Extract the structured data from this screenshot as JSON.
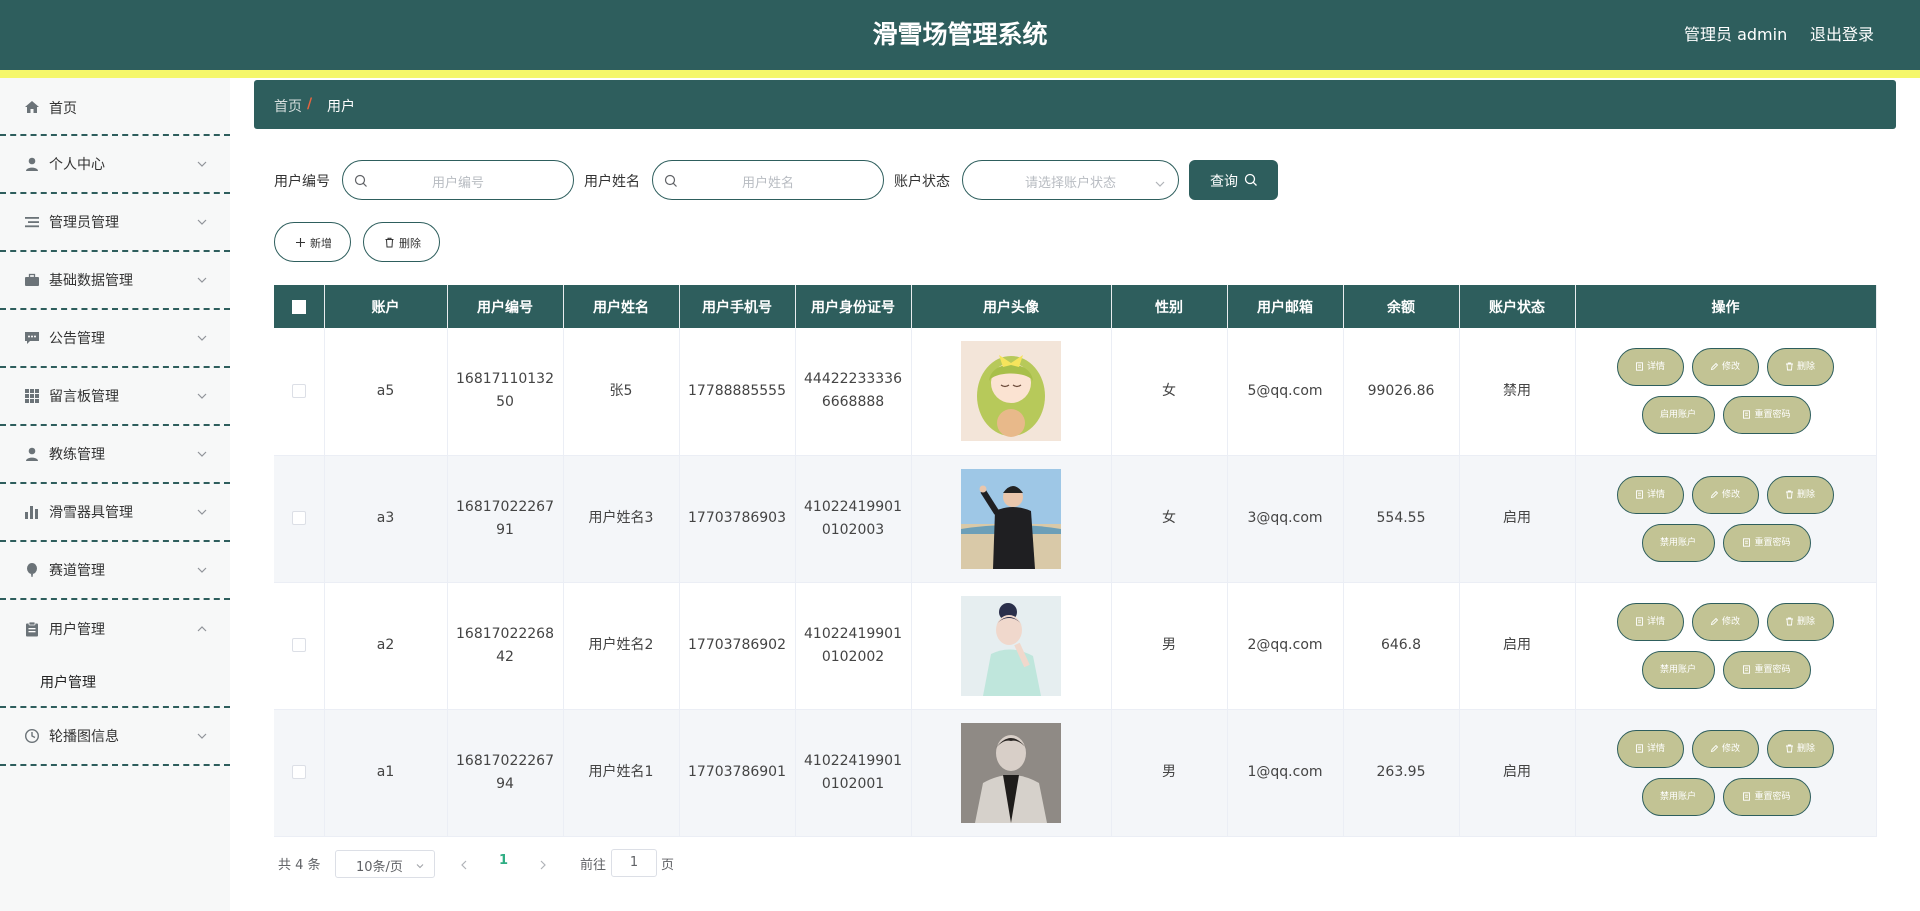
{
  "header": {
    "title": "滑雪场管理系统",
    "user": "管理员 admin",
    "logout": "退出登录"
  },
  "colors": {
    "primary": "#2e5e5d",
    "accent_line": "#f5f76b",
    "op_button": "#c2c394",
    "breadcrumb_sep": "#e7643f",
    "page_active": "#2fae84"
  },
  "sidebar": {
    "items": [
      {
        "label": "首页",
        "icon": "home-icon"
      },
      {
        "label": "个人中心",
        "icon": "user-icon"
      },
      {
        "label": "管理员管理",
        "icon": "list-icon"
      },
      {
        "label": "基础数据管理",
        "icon": "briefcase-icon"
      },
      {
        "label": "公告管理",
        "icon": "message-icon"
      },
      {
        "label": "留言板管理",
        "icon": "grid-icon"
      },
      {
        "label": "教练管理",
        "icon": "user-icon"
      },
      {
        "label": "滑雪器具管理",
        "icon": "bar-chart-icon"
      },
      {
        "label": "赛道管理",
        "icon": "balloon-icon"
      },
      {
        "label": "用户管理",
        "icon": "clipboard-icon",
        "expanded": true,
        "submenu": "用户管理"
      },
      {
        "label": "轮播图信息",
        "icon": "clock-icon"
      }
    ]
  },
  "breadcrumb": {
    "home": "首页",
    "separator": "/",
    "current": "用户"
  },
  "search": {
    "id_label": "用户编号",
    "id_placeholder": "用户编号",
    "name_label": "用户姓名",
    "name_placeholder": "用户姓名",
    "status_label": "账户状态",
    "status_placeholder": "请选择账户状态",
    "query_button": "查询"
  },
  "toolbar": {
    "add": "新增",
    "delete": "删除"
  },
  "table": {
    "columns": [
      "账户",
      "用户编号",
      "用户姓名",
      "用户手机号",
      "用户身份证号",
      "用户头像",
      "性别",
      "用户邮箱",
      "余额",
      "账户状态",
      "操作"
    ],
    "rows": [
      {
        "account": "a5",
        "user_no": "1681711013250",
        "name": "张5",
        "phone": "17788885555",
        "id_card": "444222333366668888",
        "avatar": "anime-girl-avatar",
        "gender": "女",
        "email": "5@qq.com",
        "balance": "99026.86",
        "status": "禁用",
        "toggle_label": "启用账户"
      },
      {
        "account": "a3",
        "user_no": "1681702226791",
        "name": "用户姓名3",
        "phone": "17703786903",
        "id_card": "410224199010102003",
        "avatar": "beach-person-avatar",
        "gender": "女",
        "email": "3@qq.com",
        "balance": "554.55",
        "status": "启用",
        "toggle_label": "禁用账户"
      },
      {
        "account": "a2",
        "user_no": "1681702226842",
        "name": "用户姓名2",
        "phone": "17703786902",
        "id_card": "410224199010102002",
        "avatar": "woman-portrait-avatar",
        "gender": "男",
        "email": "2@qq.com",
        "balance": "646.8",
        "status": "启用",
        "toggle_label": "禁用账户"
      },
      {
        "account": "a1",
        "user_no": "1681702226794",
        "name": "用户姓名1",
        "phone": "17703786901",
        "id_card": "410224199010102001",
        "avatar": "man-portrait-avatar",
        "gender": "男",
        "email": "1@qq.com",
        "balance": "263.95",
        "status": "启用",
        "toggle_label": "禁用账户"
      }
    ],
    "ops": {
      "detail": "详情",
      "edit": "修改",
      "delete": "删除",
      "reset_password": "重置密码"
    }
  },
  "pagination": {
    "total": "共 4 条",
    "page_size": "10条/页",
    "current_page": "1",
    "goto": "前往",
    "goto_value": "1",
    "unit": "页"
  }
}
